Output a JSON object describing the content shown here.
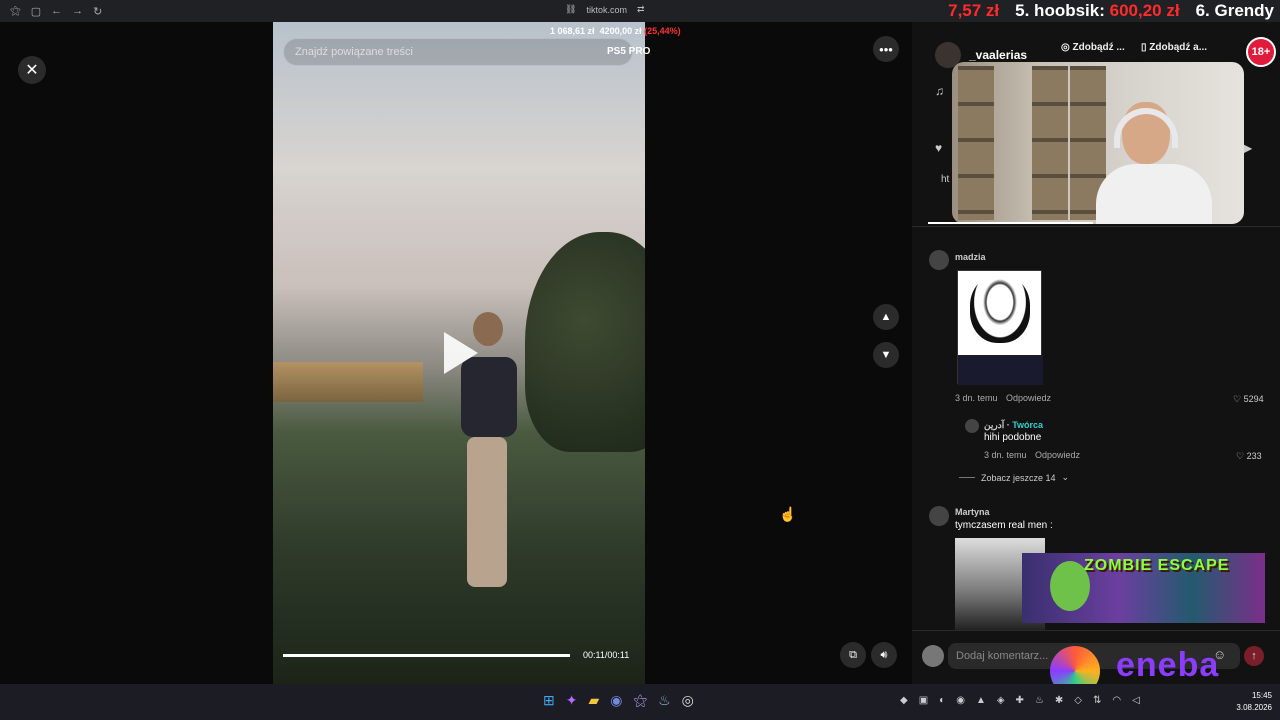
{
  "browser": {
    "url": "tiktok.com"
  },
  "ticker": [
    {
      "label": "",
      "amount": "7,57 zł"
    },
    {
      "label": "5. hoobsik:",
      "amount": "600,20 zł"
    },
    {
      "label": "6. Grendy",
      "amount": ""
    }
  ],
  "video": {
    "search_placeholder": "Znajdź powiązane treści",
    "overlay_price": "1 068,61 zł",
    "overlay_goal": "4200,00 zł",
    "overlay_pct": "(25,44%)",
    "overlay_label": "PS5 PRO",
    "time": "00:11/00:11",
    "progress": 1.0
  },
  "side": {
    "author": "_vaalerias",
    "pill1": "Zdobądź ...",
    "pill2": "Zdobądź a...",
    "age_badge": "18+",
    "link_prefix": "ht"
  },
  "comments": [
    {
      "user": "madzia",
      "meta": "3 dn. temu",
      "reply": "Odpowiedz",
      "likes": "5294"
    },
    {
      "user": "آدرين",
      "creator": "Twórca",
      "text": "hihi podobne",
      "meta": "3 dn. temu",
      "reply": "Odpowiedz",
      "likes": "233"
    },
    {
      "user": "Martyna",
      "text": "tymczasem real men :"
    }
  ],
  "see_more": "Zobacz jeszcze 14",
  "zombie_title": "ZOMBIE ESCAPE",
  "comment_input": {
    "placeholder": "Dodaj komentarz..."
  },
  "eneba": "eneba",
  "clock": {
    "time": "15:45",
    "date": "3.08.2026"
  }
}
